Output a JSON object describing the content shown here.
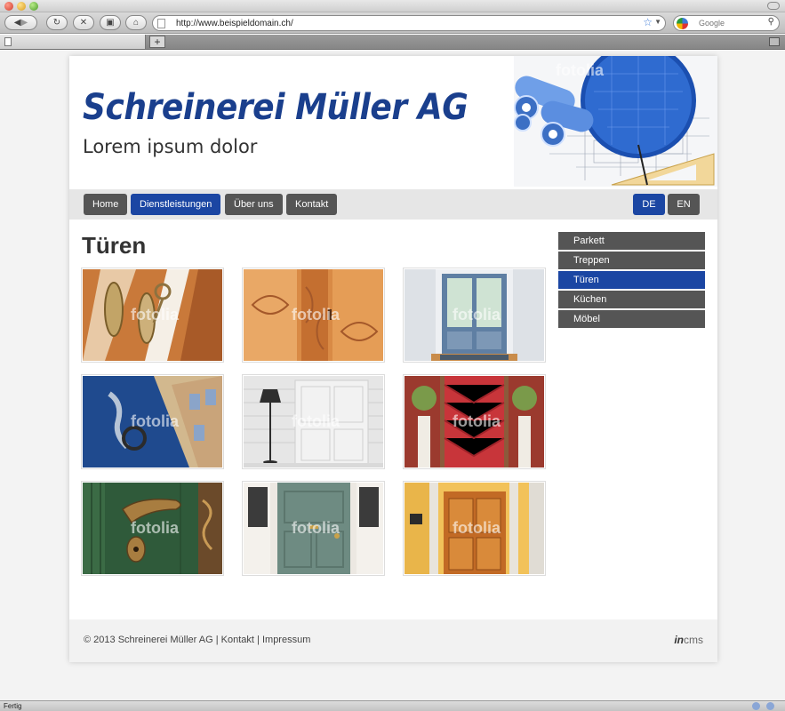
{
  "browser": {
    "url": "http://www.beispieldomain.ch/",
    "search_placeholder": "Google",
    "status": "Fertig",
    "new_tab": "+"
  },
  "header": {
    "brand": "Schreinerei Müller AG",
    "tagline": "Lorem ipsum dolor",
    "watermark": "fotolia"
  },
  "nav": {
    "items": [
      {
        "label": "Home"
      },
      {
        "label": "Dienstleistungen",
        "active": true
      },
      {
        "label": "Über uns"
      },
      {
        "label": "Kontakt"
      }
    ],
    "languages": [
      {
        "label": "DE",
        "active": true
      },
      {
        "label": "EN"
      }
    ]
  },
  "main": {
    "title": "Türen",
    "watermark": "fotolia"
  },
  "subnav": {
    "items": [
      {
        "label": "Parkett"
      },
      {
        "label": "Treppen"
      },
      {
        "label": "Türen",
        "active": true
      },
      {
        "label": "Küchen"
      },
      {
        "label": "Möbel"
      }
    ]
  },
  "footer": {
    "copyright": "© 2013 Schreinerei Müller AG",
    "separator": "|",
    "links": [
      "Kontakt",
      "Impressum"
    ],
    "cms_prefix": "in",
    "cms_suffix": "cms"
  },
  "colors": {
    "brand_blue": "#1a3f8d",
    "nav_active": "#1b46a3",
    "nav_default": "#555555"
  }
}
